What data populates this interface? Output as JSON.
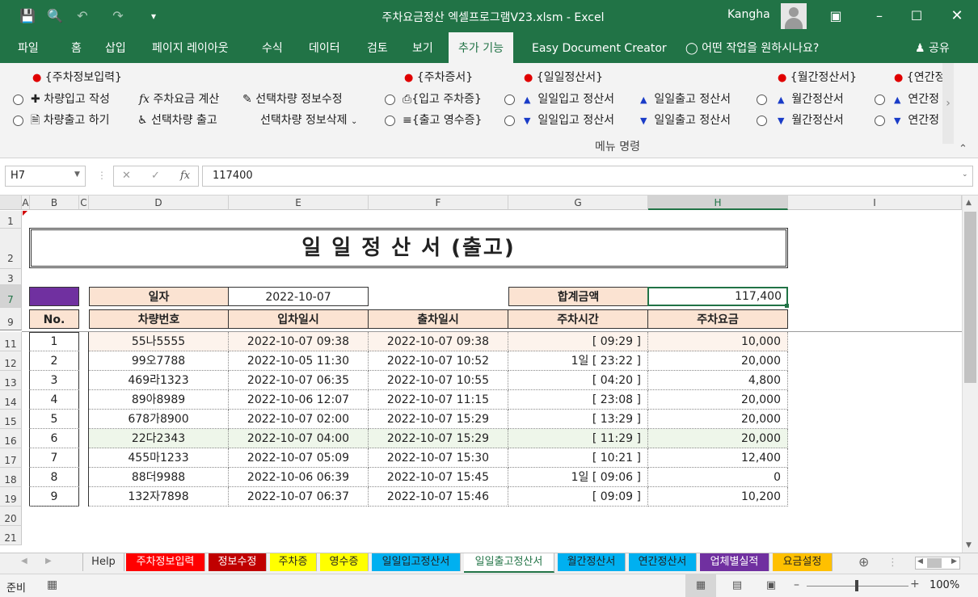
{
  "app": {
    "title": "주차요금정산 엑셀프로그램V23.xlsm  -  Excel",
    "user": "Kangha"
  },
  "ribbon_tabs": [
    "파일",
    "홈",
    "삽입",
    "페이지 레이아웃",
    "수식",
    "데이터",
    "검토",
    "보기",
    "추가 기능",
    "Easy Document Creator"
  ],
  "tell_me": "어떤 작업을 원하시나요?",
  "share": "공유",
  "ribbon": {
    "group1_title": "{주차정보입력}",
    "car_in": "차량입고 작성",
    "fee_calc": "주차요금 계산",
    "edit_selected": "선택차량 정보수정",
    "car_out": "차량출고 하기",
    "out_selected": "선택차량 출고",
    "delete_selected": "선택차량 정보삭제",
    "group2_title": "{주차증서}",
    "in_ticket": "{입고 주차증}",
    "out_receipt": "{출고 영수증}",
    "group3_title": "{일일정산서}",
    "daily_in_up": "일일입고 정산서",
    "daily_out_up": "일일출고 정산서",
    "daily_in_down": "일일입고 정산서",
    "daily_out_down": "일일출고 정산서",
    "group4_title": "{월간정산서}",
    "monthly_up": "월간정산서",
    "monthly_down": "월간정산서",
    "group5_title": "{연간정",
    "yearly_up": "연간정",
    "yearly_down": "연간정",
    "group_label": "메뉴 명령"
  },
  "formula_bar": {
    "name_box": "H7",
    "value": "117400"
  },
  "columns": [
    "A",
    "B",
    "C",
    "D",
    "E",
    "F",
    "G",
    "H",
    "I"
  ],
  "rows": [
    "1",
    "2",
    "3",
    "7",
    "9",
    "11",
    "12",
    "13",
    "14",
    "15",
    "16",
    "17",
    "18",
    "19",
    "20",
    "21"
  ],
  "sheet": {
    "title": "일 일 정 산 서 (출고)",
    "date_label": "일자",
    "date_value": "2022-10-07",
    "total_label": "합계금액",
    "total_value": "117,400",
    "headers": [
      "No.",
      "차량번호",
      "입차일시",
      "출차일시",
      "주차시간",
      "주차요금"
    ],
    "records": [
      [
        "1",
        "55나5555",
        "2022-10-07 09:38",
        "2022-10-07 09:38",
        "[ 09:29 ]",
        "10,000"
      ],
      [
        "2",
        "99오7788",
        "2022-10-05 11:30",
        "2022-10-07 10:52",
        "1일  [ 23:22 ]",
        "20,000"
      ],
      [
        "3",
        "469라1323",
        "2022-10-07 06:35",
        "2022-10-07 10:55",
        "[ 04:20 ]",
        "4,800"
      ],
      [
        "4",
        "89아8989",
        "2022-10-06 12:07",
        "2022-10-07 11:15",
        "[ 23:08 ]",
        "20,000"
      ],
      [
        "5",
        "678가8900",
        "2022-10-07 02:00",
        "2022-10-07 15:29",
        "[ 13:29 ]",
        "20,000"
      ],
      [
        "6",
        "22다2343",
        "2022-10-07 04:00",
        "2022-10-07 15:29",
        "[ 11:29 ]",
        "20,000"
      ],
      [
        "7",
        "455마1233",
        "2022-10-07 05:09",
        "2022-10-07 15:30",
        "[ 10:21 ]",
        "12,400"
      ],
      [
        "8",
        "88더9988",
        "2022-10-06 06:39",
        "2022-10-07 15:45",
        "1일  [ 09:06 ]",
        "0"
      ],
      [
        "9",
        "132자7898",
        "2022-10-07 06:37",
        "2022-10-07 15:46",
        "[ 09:09 ]",
        "10,200"
      ]
    ]
  },
  "sheet_tabs": [
    {
      "label": "Help",
      "bg": "#f0f0f0",
      "fg": "#333333"
    },
    {
      "label": "주차정보입력",
      "bg": "#ff0000",
      "fg": "#ffffff"
    },
    {
      "label": "정보수정",
      "bg": "#c00000",
      "fg": "#ffffff"
    },
    {
      "label": "주차증",
      "bg": "#ffff00",
      "fg": "#222222"
    },
    {
      "label": "영수증",
      "bg": "#ffff00",
      "fg": "#222222"
    },
    {
      "label": "일일입고정산서",
      "bg": "#00b0f0",
      "fg": "#222222"
    },
    {
      "label": "일일출고정산서",
      "bg": "#ffffff",
      "fg": "#217346"
    },
    {
      "label": "월간정산서",
      "bg": "#00b0f0",
      "fg": "#222222"
    },
    {
      "label": "연간정산서",
      "bg": "#00b0f0",
      "fg": "#222222"
    },
    {
      "label": "업체별실적",
      "bg": "#7030a0",
      "fg": "#ffffff"
    },
    {
      "label": "요금설정",
      "bg": "#ffc000",
      "fg": "#222222"
    }
  ],
  "status": {
    "ready": "준비",
    "zoom": "100%"
  },
  "colors": {
    "excel_green": "#217346",
    "header_fill": "#fbe3d2",
    "purple_cell": "#7030a0"
  }
}
